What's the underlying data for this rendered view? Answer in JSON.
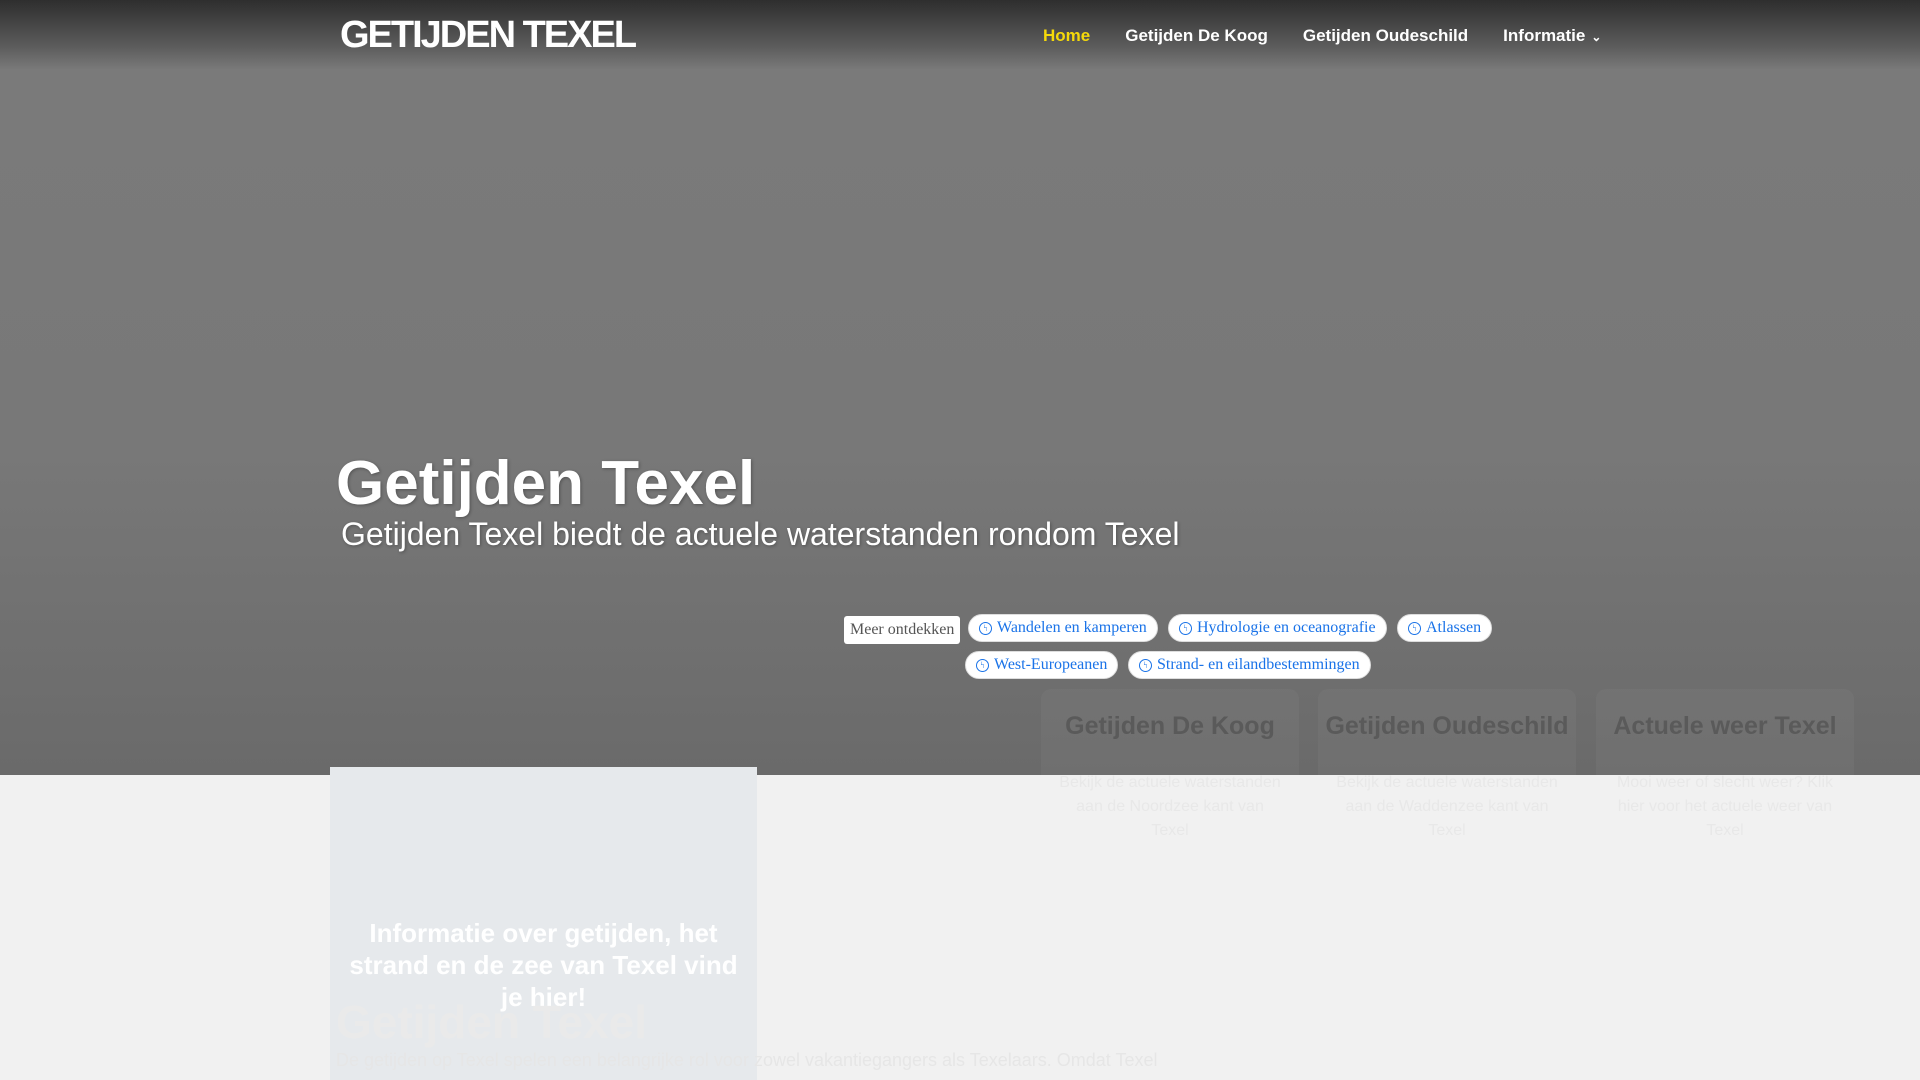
{
  "header": {
    "logo": "GETIJDEN TEXEL",
    "nav": [
      "Home",
      "Getijden De Koog",
      "Getijden Oudeschild",
      "Informatie"
    ]
  },
  "hero": {
    "title": "Getijden Texel",
    "subtitle": "Getijden Texel biedt de actuele waterstanden rondom Texel"
  },
  "discover": {
    "label": "Meer ontdekken",
    "chips": [
      "Wandelen en kamperen",
      "Hydrologie en oceanografie",
      "Atlassen",
      "West-Europeanen",
      "Strand- en eilandbestemmingen"
    ]
  },
  "cards": [
    {
      "title": "Getijden De Koog",
      "desc": "Bekijk de actuele waterstanden aan de Noordzee kant van Texel"
    },
    {
      "title": "Getijden Oudeschild",
      "desc": "Bekijk de actuele waterstanden aan de Waddenzee kant van Texel"
    },
    {
      "title": "Actuele weer Texel",
      "desc": "Mooi weer of slecht weer? Klik hier voor het actuele weer van Texel"
    }
  ],
  "info": {
    "text": "Informatie over getijden, het strand en de zee van Texel vind je hier!"
  },
  "section": {
    "title": "Getijden Texel",
    "paragraph": "De getijden op Texel spelen een belangrijke rol voor zowel vakantiegangers als Texelaars. Omdat Texel"
  }
}
